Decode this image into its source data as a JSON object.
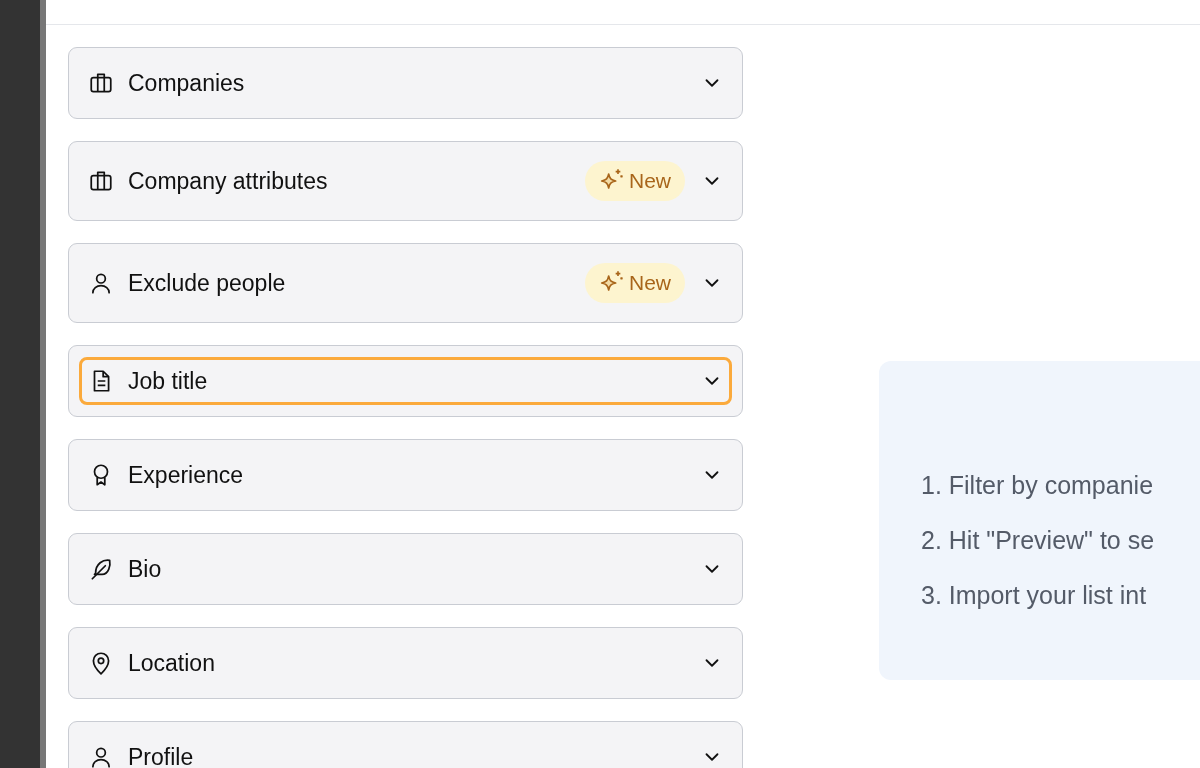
{
  "filters": [
    {
      "label": "Companies",
      "focused": false
    },
    {
      "label": "Company attributes",
      "focused": false,
      "badge": "New"
    },
    {
      "label": "Exclude people",
      "focused": false,
      "badge": "New"
    },
    {
      "label": "Job title",
      "focused": true
    },
    {
      "label": "Experience",
      "focused": false
    },
    {
      "label": "Bio",
      "focused": false
    },
    {
      "label": "Location",
      "focused": false
    },
    {
      "label": "Profile",
      "focused": false
    }
  ],
  "steps": [
    "1. Filter by companie",
    "2. Hit \"Preview\" to se",
    "3. Import your list int"
  ]
}
